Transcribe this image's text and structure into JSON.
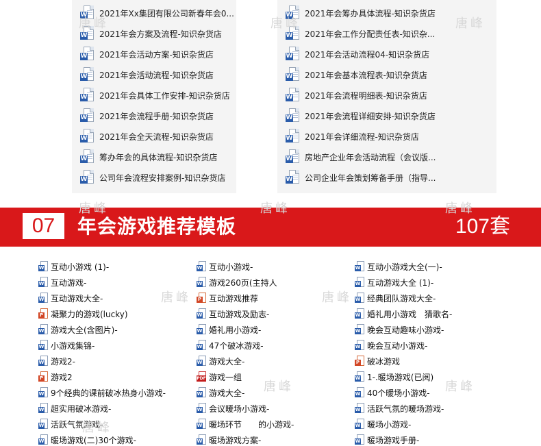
{
  "watermark": "唐峰",
  "top_files": {
    "left": [
      "2021年Xx集团有限公司新春年会0...",
      "2021年会方案及流程-知识杂货店",
      "2021年会活动方案-知识杂货店",
      "2021年会活动流程-知识杂货店",
      "2021年会具体工作安排-知识杂货店",
      "2021年会流程手册-知识杂货店",
      "2021年会全天流程-知识杂货店",
      "筹办年会的具体流程-知识杂货店",
      "公司年会流程安排案例-知识杂货店"
    ],
    "right": [
      "2021年会筹办具体流程-知识杂货店",
      "2021年会工作分配责任表-知识杂...",
      "2021年会活动流程04-知识杂货店",
      "2021年会基本流程表-知识杂货店",
      "2021年会流程明细表-知识杂货店",
      "2021年会流程详细安排-知识杂货店",
      "2021年会详细流程-知识杂货店",
      "房地产企业年会活动流程（会议版...",
      "公司企业年会策划筹备手册（指导..."
    ]
  },
  "banner": {
    "number": "07",
    "title": "年会游戏推荐模板",
    "count": "107套",
    "color": "#d9181a"
  },
  "games": {
    "col1": [
      {
        "label": "互动小游戏 (1)-",
        "icon": "word-doc-icon"
      },
      {
        "label": "互动游戏-",
        "icon": "word-doc-icon"
      },
      {
        "label": "互动游戏大全-",
        "icon": "word-doc-icon"
      },
      {
        "label": "凝聚力的游戏(lucky)",
        "icon": "ppt-doc-icon"
      },
      {
        "label": "游戏大全(含图片)-",
        "icon": "word-doc-icon"
      },
      {
        "label": "小游戏集锦-",
        "icon": "word-doc-icon"
      },
      {
        "label": "游戏2-",
        "icon": "word-doc-icon"
      },
      {
        "label": "游戏2",
        "icon": "ppt-doc-icon"
      },
      {
        "label": "9个经典的课前破冰热身小游戏-",
        "icon": "word-doc-icon"
      },
      {
        "label": "超实用破冰游戏-",
        "icon": "word-doc-icon"
      },
      {
        "label": "活跃气氛游戏-",
        "icon": "word-doc-icon"
      },
      {
        "label": "暖场游戏(二)30个游戏-",
        "icon": "word-doc-icon"
      }
    ],
    "col2": [
      {
        "label": "互动小游戏-",
        "icon": "word-doc-icon"
      },
      {
        "label": "游戏260页(主持人",
        "icon": "word-doc-icon"
      },
      {
        "label": "互动游戏推荐",
        "icon": "ppt-doc-icon"
      },
      {
        "label": "互动游戏及励志-",
        "icon": "word-doc-icon"
      },
      {
        "label": "婚礼用小游戏-",
        "icon": "word-doc-icon"
      },
      {
        "label": "47个破冰游戏-",
        "icon": "word-doc-icon"
      },
      {
        "label": "游戏大全-",
        "icon": "word-doc-icon"
      },
      {
        "label": "游戏一组",
        "icon": "pdf-doc-icon"
      },
      {
        "label": "游戏大全-",
        "icon": "word-doc-icon"
      },
      {
        "label": "会议暖场小游戏-",
        "icon": "word-doc-icon"
      },
      {
        "label": "暖场环节　　的小游戏-",
        "icon": "word-doc-icon"
      },
      {
        "label": "暖场游戏方案-",
        "icon": "word-doc-icon"
      }
    ],
    "col3": [
      {
        "label": "互动小游戏大全(一)-",
        "icon": "word-doc-icon"
      },
      {
        "label": "互动游戏大全 (1)-",
        "icon": "word-doc-icon"
      },
      {
        "label": "经典团队游戏大全-",
        "icon": "word-doc-icon"
      },
      {
        "label": "婚礼用小游戏　猜歌名-",
        "icon": "word-doc-icon"
      },
      {
        "label": "晚会互动趣味小游戏-",
        "icon": "word-doc-icon"
      },
      {
        "label": "晚会互动小游戏-",
        "icon": "word-doc-icon"
      },
      {
        "label": "破冰游戏",
        "icon": "ppt-doc-icon"
      },
      {
        "label": "1-.暖场游戏(已阅)",
        "icon": "word-doc-icon"
      },
      {
        "label": "40个暖场小游戏-",
        "icon": "word-doc-icon"
      },
      {
        "label": "活跃气氛的暖场游戏-",
        "icon": "word-doc-icon"
      },
      {
        "label": "暖场小游戏-",
        "icon": "word-doc-icon"
      },
      {
        "label": "暖场游戏手册-",
        "icon": "word-doc-icon"
      }
    ]
  }
}
